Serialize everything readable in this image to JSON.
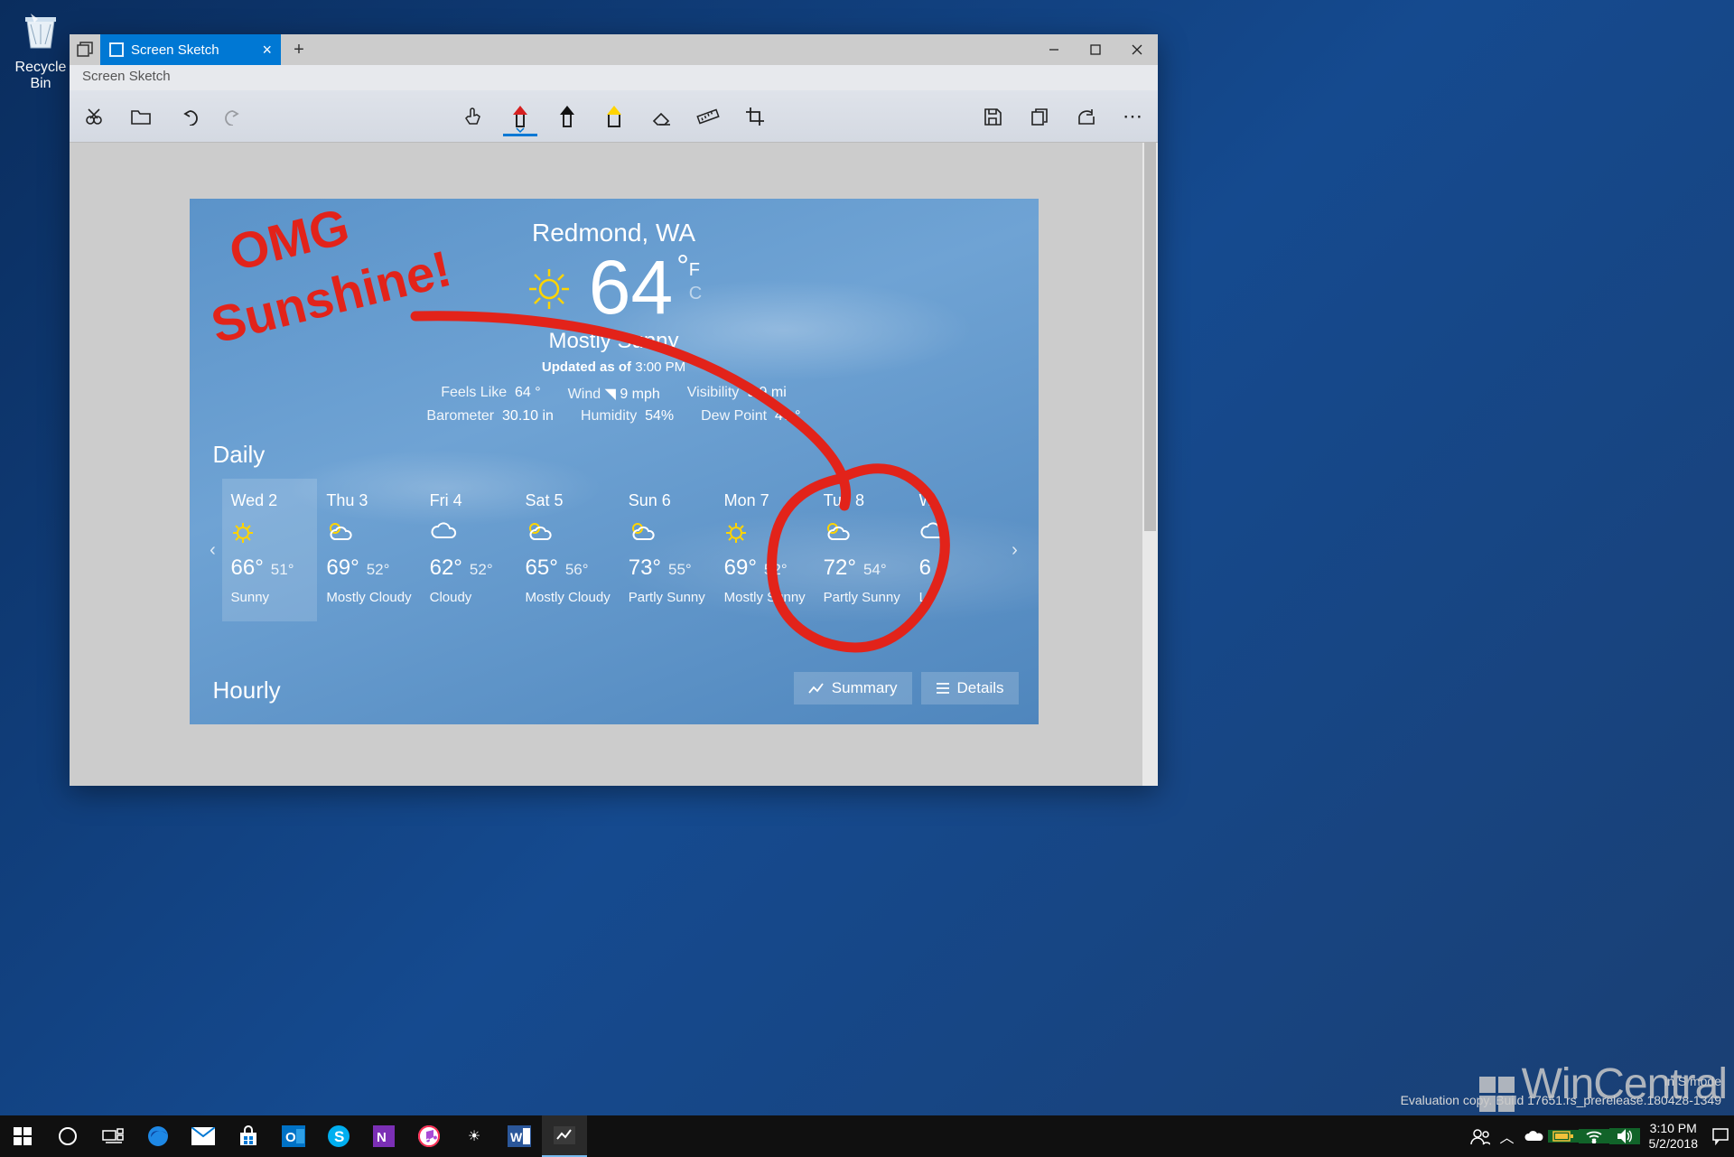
{
  "desktop": {
    "recycle_bin": "Recycle Bin"
  },
  "window": {
    "tab_title": "Screen Sketch",
    "app_title": "Screen Sketch"
  },
  "tools": {
    "snip": "New snip",
    "open": "Open",
    "undo": "Undo",
    "redo": "Redo",
    "touch": "Touch writing",
    "pen": "Ballpoint pen",
    "pencil": "Pencil",
    "highlighter": "Highlighter",
    "eraser": "Eraser",
    "ruler": "Ruler",
    "crop": "Crop",
    "save": "Save",
    "copy": "Copy",
    "share": "Share",
    "more": "More"
  },
  "annotation_text": "OMG Sunshine!",
  "weather": {
    "location": "Redmond, WA",
    "temp": "64",
    "unit_f": "F",
    "unit_c": "C",
    "condition": "Mostly Sunny",
    "updated_label": "Updated as of",
    "updated_time": "3:00 PM",
    "feels_label": "Feels Like",
    "feels": "64 °",
    "wind_label": "Wind",
    "wind": "9 mph",
    "vis_label": "Visibility",
    "vis": "9.9 mi",
    "baro_label": "Barometer",
    "baro": "30.10 in",
    "hum_label": "Humidity",
    "hum": "54%",
    "dew_label": "Dew Point",
    "dew": "47 °",
    "daily_heading": "Daily",
    "hourly_heading": "Hourly",
    "summary_btn": "Summary",
    "details_btn": "Details",
    "days": [
      {
        "name": "Wed 2",
        "hi": "66°",
        "lo": "51°",
        "cond": "Sunny",
        "icon": "sun"
      },
      {
        "name": "Thu 3",
        "hi": "69°",
        "lo": "52°",
        "cond": "Mostly Cloudy",
        "icon": "pc"
      },
      {
        "name": "Fri 4",
        "hi": "62°",
        "lo": "52°",
        "cond": "Cloudy",
        "icon": "cloud"
      },
      {
        "name": "Sat 5",
        "hi": "65°",
        "lo": "56°",
        "cond": "Mostly Cloudy",
        "icon": "pc"
      },
      {
        "name": "Sun 6",
        "hi": "73°",
        "lo": "55°",
        "cond": "Partly Sunny",
        "icon": "pc"
      },
      {
        "name": "Mon 7",
        "hi": "69°",
        "lo": "52°",
        "cond": "Mostly Sunny",
        "icon": "sun"
      },
      {
        "name": "Tue 8",
        "hi": "72°",
        "lo": "54°",
        "cond": "Partly Sunny",
        "icon": "pc"
      },
      {
        "name": "W",
        "hi": "6",
        "lo": "",
        "cond": "L",
        "icon": "cloud"
      }
    ]
  },
  "system": {
    "s_mode": "in S mode",
    "build": "Evaluation copy. Build 17651.rs_prerelease.180428-1349",
    "time": "3:10 PM",
    "date": "5/2/2018",
    "brand": "WinCentral"
  }
}
